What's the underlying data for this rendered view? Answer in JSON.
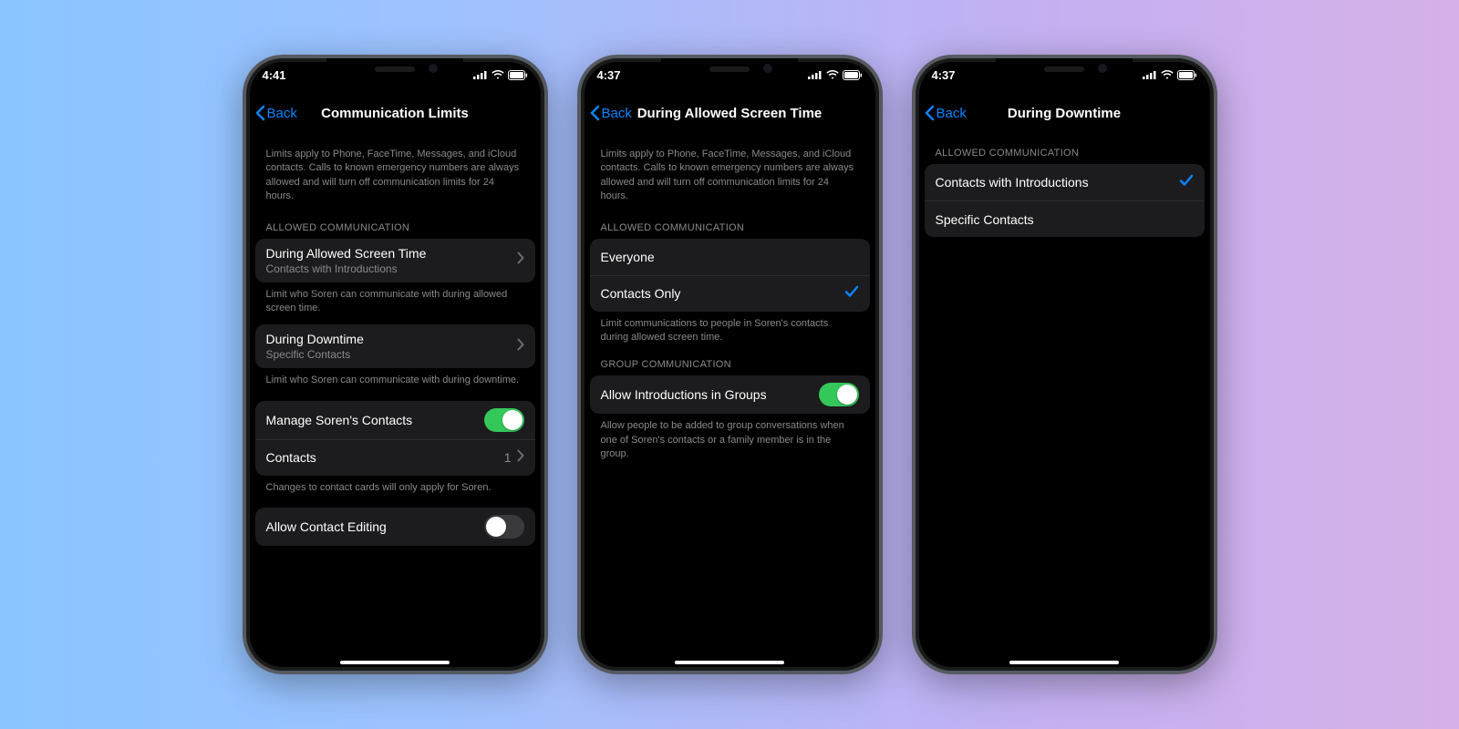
{
  "phone1": {
    "time": "4:41",
    "back": "Back",
    "title": "Communication Limits",
    "intro": "Limits apply to Phone, FaceTime, Messages, and iCloud contacts. Calls to known emergency numbers are always allowed and will turn off communication limits for 24 hours.",
    "sectionHeader": "ALLOWED COMMUNICATION",
    "row1": {
      "title": "During Allowed Screen Time",
      "sub": "Contacts with Introductions"
    },
    "row1footer": "Limit who Soren can communicate with during allowed screen time.",
    "row2": {
      "title": "During Downtime",
      "sub": "Specific Contacts"
    },
    "row2footer": "Limit who Soren can communicate with during downtime.",
    "row3": "Manage Soren's Contacts",
    "row4": {
      "title": "Contacts",
      "value": "1"
    },
    "row4footer": "Changes to contact cards will only apply for Soren.",
    "row5": "Allow Contact Editing"
  },
  "phone2": {
    "time": "4:37",
    "back": "Back",
    "title": "During Allowed Screen Time",
    "intro": "Limits apply to Phone, FaceTime, Messages, and iCloud contacts. Calls to known emergency numbers are always allowed and will turn off communication limits for 24 hours.",
    "sectionHeader": "ALLOWED COMMUNICATION",
    "opt1": "Everyone",
    "opt2": "Contacts Only",
    "opt2footer": "Limit communications to people in Soren's contacts during allowed screen time.",
    "section2Header": "GROUP COMMUNICATION",
    "row3": "Allow Introductions in Groups",
    "row3footer": "Allow people to be added to group conversations when one of Soren's contacts or a family member is in the group."
  },
  "phone3": {
    "time": "4:37",
    "back": "Back",
    "title": "During Downtime",
    "sectionHeader": "ALLOWED COMMUNICATION",
    "opt1": "Contacts with Introductions",
    "opt2": "Specific Contacts"
  }
}
